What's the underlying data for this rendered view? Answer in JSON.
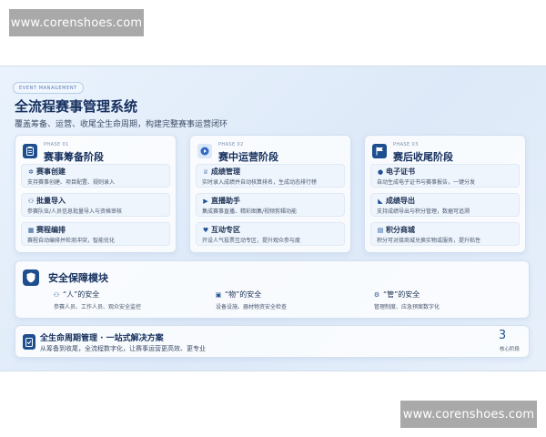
{
  "watermarks": {
    "top": "www.corenshoes.com",
    "bottom": "www.corenshoes.com"
  },
  "header": {
    "tag": "EVENT MANAGEMENT",
    "title": "全流程赛事管理系统",
    "subtitle": "覆盖筹备、运营、收尾全生命周期，构建完整赛事运营闭环"
  },
  "phases": [
    {
      "kicker": "PHASE 01",
      "title": "赛事筹备阶段",
      "items": [
        {
          "icon": "gear-icon",
          "title": "赛事创建",
          "desc": "支持赛事创建、项目配置、规则录入"
        },
        {
          "icon": "group-icon",
          "title": "批量导入",
          "desc": "参赛队伍/人员信息批量导入与资格审核"
        },
        {
          "icon": "calendar-icon",
          "title": "赛程编排",
          "desc": "赛程自动编排并检测冲突，智能优化"
        }
      ]
    },
    {
      "kicker": "PHASE 02",
      "title": "赛中运营阶段",
      "items": [
        {
          "icon": "trophy-icon",
          "title": "成绩管理",
          "desc": "实时录入成绩并自动核算排名，生成动态排行榜"
        },
        {
          "icon": "video-icon",
          "title": "直播助手",
          "desc": "集成赛事直播、精彩图集/视频剪辑功能"
        },
        {
          "icon": "heart-icon",
          "title": "互动专区",
          "desc": "开设人气投票互动专区，提升观众参与度"
        }
      ]
    },
    {
      "kicker": "PHASE 03",
      "title": "赛后收尾阶段",
      "items": [
        {
          "icon": "certificate-icon",
          "title": "电子证书",
          "desc": "自动生成电子证书与赛事报告，一键分发"
        },
        {
          "icon": "export-icon",
          "title": "成绩导出",
          "desc": "支持成绩导出与积分管理，数据可追溯"
        },
        {
          "icon": "store-icon",
          "title": "积分商城",
          "desc": "积分可对接商城兑换实物或服务，提升粘性"
        }
      ]
    }
  ],
  "safety": {
    "title": "安全保障模块",
    "columns": [
      {
        "icon": "people-icon",
        "title": "“人”的安全",
        "desc": "参赛人员、工作人员、观众安全监控"
      },
      {
        "icon": "equipment-icon",
        "title": "“物”的安全",
        "desc": "设备设施、器材物资安全检查"
      },
      {
        "icon": "management-icon",
        "title": "“管”的安全",
        "desc": "管理制度、应急预案数字化"
      }
    ]
  },
  "summary": {
    "title": "全生命周期管理 · 一站式解决方案",
    "subtitle": "从筹备到收尾，全流程数字化，让赛事运营更高效、更专业",
    "stat_value": "3",
    "stat_label": "核心阶段"
  }
}
